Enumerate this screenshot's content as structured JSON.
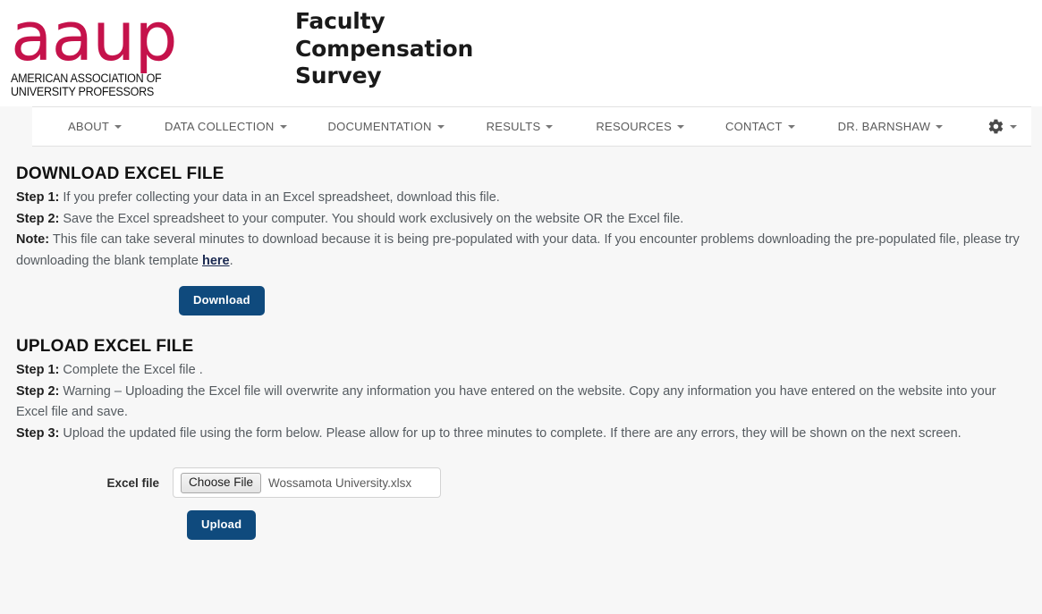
{
  "header": {
    "logo_word": "aaup",
    "logo_sub_line1": "AMERICAN ASSOCIATION OF",
    "logo_sub_line2": "UNIVERSITY PROFESSORS",
    "logo_color": "#c5124b",
    "site_title_line1": "Faculty",
    "site_title_line2": "Compensation",
    "site_title_line3": "Survey"
  },
  "nav": {
    "items": [
      {
        "label": "ABOUT",
        "has_caret": true
      },
      {
        "label": "DATA COLLECTION",
        "has_caret": true
      },
      {
        "label": "DOCUMENTATION",
        "has_caret": true
      },
      {
        "label": "RESULTS",
        "has_caret": true
      },
      {
        "label": "RESOURCES",
        "has_caret": true
      },
      {
        "label": "CONTACT",
        "has_caret": true
      },
      {
        "label": "DR. BARNSHAW",
        "has_caret": true
      }
    ],
    "gear_icon": "gear-icon"
  },
  "download_section": {
    "title": "DOWNLOAD EXCEL FILE",
    "step1_label": "Step 1:",
    "step1_text": "If you prefer collecting your data in an Excel spreadsheet, download this file.",
    "step2_label": "Step 2:",
    "step2_text": "Save the Excel spreadsheet to your computer. You should work exclusively on the website OR the Excel file.",
    "note_label": "Note:",
    "note_text_part1": "This file can take several minutes to download because it is being pre-populated with your data. If you encounter problems downloading the pre-populated file, please try downloading the blank template ",
    "note_link": "here",
    "note_text_part2": ".",
    "download_button": "Download"
  },
  "upload_section": {
    "title": "UPLOAD EXCEL FILE",
    "step1_label": "Step 1:",
    "step1_text": "Complete the Excel file .",
    "step2_label": "Step 2:",
    "step2_text": "Warning – Uploading the Excel file will overwrite any information you have entered on the website. Copy any information you have entered on the website into your Excel file and save.",
    "step3_label": "Step 3:",
    "step3_text": "Upload the updated file using the form below. Please allow for up to three minutes to complete. If there are any errors, they will be shown on the next screen.",
    "file_label": "Excel file",
    "choose_file_button": "Choose File",
    "file_name": "Wossamota University.xlsx",
    "upload_button": "Upload"
  },
  "colors": {
    "brand_crimson": "#c5124b",
    "button_navy": "#0f4a7d",
    "link_navy": "#1b2a52",
    "page_background": "#f7f7f7"
  }
}
